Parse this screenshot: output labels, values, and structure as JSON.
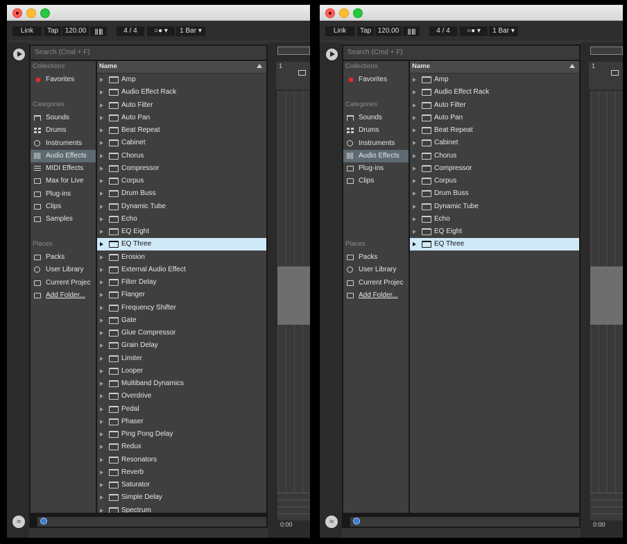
{
  "control_bar": {
    "link": "Link",
    "tap": "Tap",
    "tempo": "120.00",
    "meter_icon": "||| ||||",
    "time_signature": "4 / 4",
    "metronome": "○● ▾",
    "quantization": "1 Bar ▾"
  },
  "browser": {
    "search_placeholder": "Search (Cmd + F)",
    "sections": {
      "collections": "Collections",
      "categories": "Categories",
      "places": "Places"
    },
    "collections": [
      {
        "label": "Favorites",
        "icon": "red-dot-icon"
      }
    ],
    "list_header": "Name",
    "selected_item": "EQ Three"
  },
  "left_window": {
    "categories": [
      {
        "label": "Sounds",
        "icon": "note-icon"
      },
      {
        "label": "Drums",
        "icon": "grid-icon"
      },
      {
        "label": "Instruments",
        "icon": "clock-icon"
      },
      {
        "label": "Audio Effects",
        "icon": "waveform-icon",
        "selected": true
      },
      {
        "label": "MIDI Effects",
        "icon": "midi-icon"
      },
      {
        "label": "Max for Live",
        "icon": "max-icon"
      },
      {
        "label": "Plug-ins",
        "icon": "plugin-icon"
      },
      {
        "label": "Clips",
        "icon": "clip-icon"
      },
      {
        "label": "Samples",
        "icon": "sample-icon"
      }
    ],
    "places": [
      {
        "label": "Packs",
        "icon": "packs-icon"
      },
      {
        "label": "User Library",
        "icon": "user-icon"
      },
      {
        "label": "Current Projec",
        "icon": "folder-icon"
      },
      {
        "label": "Add Folder...",
        "icon": "add-folder-icon"
      }
    ],
    "items": [
      "Amp",
      "Audio Effect Rack",
      "Auto Filter",
      "Auto Pan",
      "Beat Repeat",
      "Cabinet",
      "Chorus",
      "Compressor",
      "Corpus",
      "Drum Buss",
      "Dynamic Tube",
      "Echo",
      "EQ Eight",
      "EQ Three",
      "Erosion",
      "External Audio Effect",
      "Filter Delay",
      "Flanger",
      "Frequency Shifter",
      "Gate",
      "Glue Compressor",
      "Grain Delay",
      "Limiter",
      "Looper",
      "Multiband Dynamics",
      "Overdrive",
      "Pedal",
      "Phaser",
      "Ping Pong Delay",
      "Redux",
      "Resonators",
      "Reverb",
      "Saturator",
      "Simple Delay",
      "Spectrum"
    ]
  },
  "right_window": {
    "categories": [
      {
        "label": "Sounds",
        "icon": "note-icon"
      },
      {
        "label": "Drums",
        "icon": "grid-icon"
      },
      {
        "label": "Instruments",
        "icon": "clock-icon"
      },
      {
        "label": "Audio Effects",
        "icon": "waveform-icon",
        "selected": true
      },
      {
        "label": "Plug-ins",
        "icon": "plugin-icon"
      },
      {
        "label": "Clips",
        "icon": "clip-icon"
      }
    ],
    "places": [
      {
        "label": "Packs",
        "icon": "packs-icon"
      },
      {
        "label": "User Library",
        "icon": "user-icon"
      },
      {
        "label": "Current Projec",
        "icon": "folder-icon"
      },
      {
        "label": "Add Folder...",
        "icon": "add-folder-icon"
      }
    ],
    "items": [
      "Amp",
      "Audio Effect Rack",
      "Auto Filter",
      "Auto Pan",
      "Beat Repeat",
      "Cabinet",
      "Chorus",
      "Compressor",
      "Corpus",
      "Drum Buss",
      "Dynamic Tube",
      "Echo",
      "EQ Eight",
      "EQ Three"
    ]
  },
  "arrangement": {
    "bar_number": "1",
    "time": "0:00"
  },
  "colors": {
    "selected_row": "#cfe9f7",
    "selected_category": "#5d6a72",
    "favorite": "#e22c2c"
  }
}
